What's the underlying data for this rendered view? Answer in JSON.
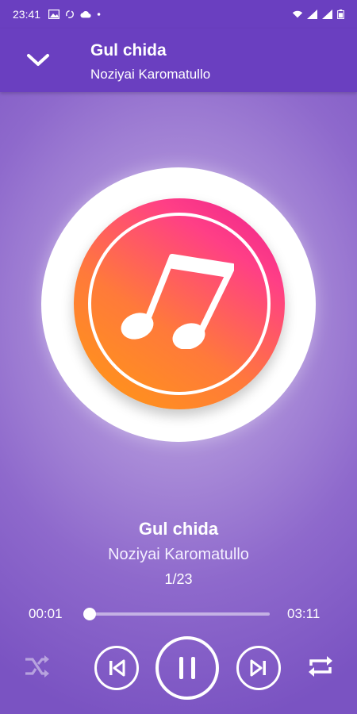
{
  "status_bar": {
    "time": "23:41",
    "left_icons": [
      "image-icon",
      "sync-icon",
      "cloud-icon",
      "dot-icon"
    ],
    "right_icons": [
      "wifi-icon",
      "signal-icon",
      "signal-icon",
      "battery-icon"
    ]
  },
  "header": {
    "title": "Gul chida",
    "artist": "Noziyai Karomatullo",
    "collapse_icon": "chevron-down-icon"
  },
  "album_art": {
    "icon": "music-note-icon",
    "gradient": [
      "#ff9a12",
      "#ff3f86",
      "#e91e8f"
    ]
  },
  "now_playing": {
    "title": "Gul chida",
    "artist": "Noziyai Karomatullo",
    "index": "1/23"
  },
  "progress": {
    "elapsed": "00:01",
    "total": "03:11",
    "fraction": 0.005
  },
  "controls": {
    "shuffle": {
      "icon": "shuffle-icon",
      "enabled": false
    },
    "previous": {
      "icon": "skip-previous-icon"
    },
    "play_pause": {
      "icon": "pause-icon",
      "state": "playing"
    },
    "next": {
      "icon": "skip-next-icon"
    },
    "repeat": {
      "icon": "repeat-icon",
      "enabled": true
    }
  },
  "colors": {
    "header_bg": "#6a3fc0",
    "background": "#8e69cc",
    "accent": "#ffffff"
  }
}
